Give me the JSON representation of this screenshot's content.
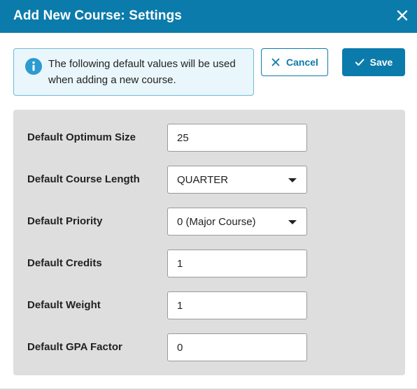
{
  "dialog": {
    "title": "Add New Course: Settings",
    "close_icon": "close-icon"
  },
  "info": {
    "icon": "info-icon",
    "message": "The following default values will be used when adding a new course."
  },
  "actions": {
    "cancel_label": "Cancel",
    "cancel_icon": "close-icon",
    "save_label": "Save",
    "save_icon": "checkmark-icon"
  },
  "fields": [
    {
      "label": "Default Optimum Size",
      "value": "25",
      "type": "text"
    },
    {
      "label": "Default Course Length",
      "value": "QUARTER",
      "type": "select"
    },
    {
      "label": "Default Priority",
      "value": "0 (Major Course)",
      "type": "select"
    },
    {
      "label": "Default Credits",
      "value": "1",
      "type": "text"
    },
    {
      "label": "Default Weight",
      "value": "1",
      "type": "text"
    },
    {
      "label": "Default GPA Factor",
      "value": "0",
      "type": "text"
    }
  ],
  "colors": {
    "accent": "#0b7bab",
    "info_background": "#e9f6fb",
    "info_icon": "#2b9bd0",
    "panel_background": "#dedede"
  }
}
